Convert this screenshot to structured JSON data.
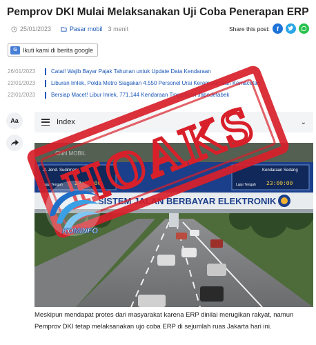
{
  "article": {
    "title": "Pemprov DKI Mulai Melaksanakan Uji Coba Penerapan ERP",
    "date": "25/01/2023",
    "category": "Pasar mobil",
    "read_time": "3 menit",
    "caption": "Meskipun mendapat protes dari masyarakat karena ERP dinilai merugikan rakyat, namun Pemprov DKI tetap melaksanakan ujo coba ERP di sejumlah ruas Jakarta hari ini."
  },
  "share": {
    "label": "Share this post:",
    "icons": [
      "facebook-icon",
      "twitter-icon",
      "whatsapp-icon"
    ]
  },
  "google_news": {
    "label": "Ikuti kami di berita google"
  },
  "related": [
    {
      "date": "26/01/2023",
      "text": "Catat! Wajib Bayar Pajak Tahunan untuk Update Data Kendaraan"
    },
    {
      "date": "22/01/2023",
      "text": "Liburan Imlek, Polda Metro Siagakan 4.550 Personel Urai Keramaian dan Kemacetan"
    },
    {
      "date": "22/01/2023",
      "text": "Bersiap Macet! Libur Imlek, 771.144 Kendaraan Tinggalkan Jabodetabek"
    }
  ],
  "tools": {
    "font_size": "Aa"
  },
  "index": {
    "label": "Index"
  },
  "photo": {
    "gantry_text": "SISTEM JALAN BERBAYAR ELEKTRONIK",
    "left_sign_top": "Jl. Jend. Sudirman",
    "right_sign_top": "Kendaraan Sedang",
    "sign_label_a": "Lajur Tengah",
    "sign_label_b": "Lajur Tengah",
    "left_time": "23:00:00",
    "right_time": "23:00:00",
    "watermark": "CNN MOBIL"
  },
  "stamp": {
    "text": "HOAKS"
  },
  "logo": {
    "text": "KOMINFO"
  },
  "colors": {
    "title": "#222222",
    "link": "#1a57b8",
    "stamp_red": "#d8202a",
    "facebook": "#1e73d8",
    "twitter": "#2aa6e6",
    "whatsapp": "#27c24c"
  }
}
